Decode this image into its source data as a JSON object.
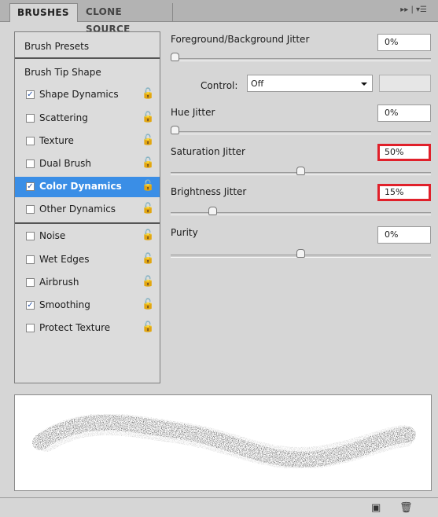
{
  "tabs": {
    "active": "BRUSHES",
    "inactive": "CLONE SOURCE",
    "menu_icons": "▸▸ | ▾☰"
  },
  "sidebar": {
    "presets": "Brush Presets",
    "tip_shape": "Brush Tip Shape",
    "options": [
      {
        "label": "Shape Dynamics",
        "checked": "✓"
      },
      {
        "label": "Scattering",
        "checked": ""
      },
      {
        "label": "Texture",
        "checked": ""
      },
      {
        "label": "Dual Brush",
        "checked": ""
      },
      {
        "label": "Color Dynamics",
        "checked": "✓"
      },
      {
        "label": "Other Dynamics",
        "checked": ""
      },
      {
        "label": "Noise",
        "checked": ""
      },
      {
        "label": "Wet Edges",
        "checked": ""
      },
      {
        "label": "Airbrush",
        "checked": ""
      },
      {
        "label": "Smoothing",
        "checked": "✓"
      },
      {
        "label": "Protect Texture",
        "checked": ""
      }
    ],
    "lock_glyph": "🔓"
  },
  "controls": {
    "fg_bg_jitter": {
      "label": "Foreground/Background Jitter",
      "value": "0%"
    },
    "control": {
      "label": "Control:",
      "value": "Off"
    },
    "hue_jitter": {
      "label": "Hue Jitter",
      "value": "0%"
    },
    "saturation_jitter": {
      "label": "Saturation Jitter",
      "value": "50%"
    },
    "brightness_jitter": {
      "label": "Brightness Jitter",
      "value": "15%"
    },
    "purity": {
      "label": "Purity",
      "value": "0%"
    }
  },
  "slider_levels": {
    "fg_bg_jitter": 0,
    "hue_jitter": 0,
    "saturation_jitter": 0.5,
    "brightness_jitter": 0.15,
    "purity": 0.5
  },
  "bottom": {
    "new_icon": "▣",
    "trash_icon": "🗑"
  },
  "colors": {
    "selection": "#3a8ee6",
    "highlight": "#e0202a"
  }
}
